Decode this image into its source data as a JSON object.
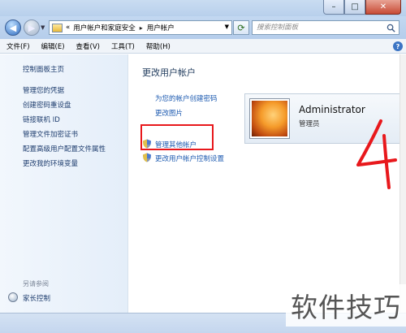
{
  "window": {
    "controls": {
      "minimize": "–",
      "maximize": "□",
      "close": "✕"
    }
  },
  "nav": {
    "breadcrumb": [
      "用户帐户和家庭安全",
      "用户帐户"
    ],
    "breadcrumb_prefix": "«",
    "separator": "▸",
    "search_placeholder": "搜索控制面板"
  },
  "menu": [
    "文件(F)",
    "编辑(E)",
    "查看(V)",
    "工具(T)",
    "帮助(H)"
  ],
  "sidebar": {
    "home": "控制面板主页",
    "links": [
      "管理您的凭据",
      "创建密码重设盘",
      "链接联机 ID",
      "管理文件加密证书",
      "配置高级用户配置文件属性",
      "更改我的环境变量"
    ],
    "see_also_label": "另请参阅",
    "see_also": [
      "家长控制"
    ]
  },
  "main": {
    "title": "更改用户帐户",
    "links": [
      "为您的帐户创建密码",
      "更改图片"
    ],
    "manage_other": "管理其他帐户",
    "uac_settings": "更改用户帐户控制设置"
  },
  "account": {
    "name": "Administrator",
    "role": "管理员"
  },
  "annotation_text": "4",
  "watermark": "软件技巧",
  "colors": {
    "highlight": "#e8181c",
    "link": "#1c5ab0"
  }
}
